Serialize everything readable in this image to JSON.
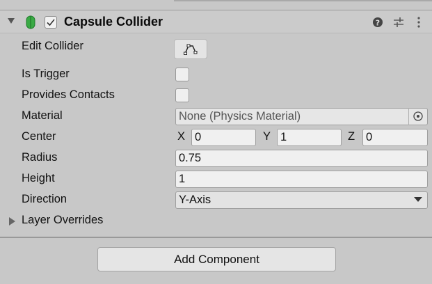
{
  "component": {
    "title": "Capsule Collider",
    "enabled": true,
    "icons": [
      "help-icon",
      "preset-icon",
      "menu-icon"
    ]
  },
  "properties": {
    "edit_collider": {
      "label": "Edit Collider",
      "icon": "edit-collider-icon"
    },
    "is_trigger": {
      "label": "Is Trigger",
      "checked": false
    },
    "provides_contacts": {
      "label": "Provides Contacts",
      "checked": false
    },
    "material": {
      "label": "Material",
      "value": "None (Physics Material)",
      "icon": "object-picker-icon"
    },
    "center": {
      "label": "Center",
      "x_label": "X",
      "x": "0",
      "y_label": "Y",
      "y": "1",
      "z_label": "Z",
      "z": "0"
    },
    "radius": {
      "label": "Radius",
      "value": "0.75"
    },
    "height": {
      "label": "Height",
      "value": "1"
    },
    "direction": {
      "label": "Direction",
      "value": "Y-Axis"
    },
    "layer_overrides": {
      "label": "Layer Overrides",
      "expanded": false
    }
  },
  "footer": {
    "add_component_label": "Add Component"
  },
  "colors": {
    "capsule_icon": "#2e9d3a",
    "panel_bg": "#c8c8c8",
    "field_bg": "#f0f0f0"
  }
}
